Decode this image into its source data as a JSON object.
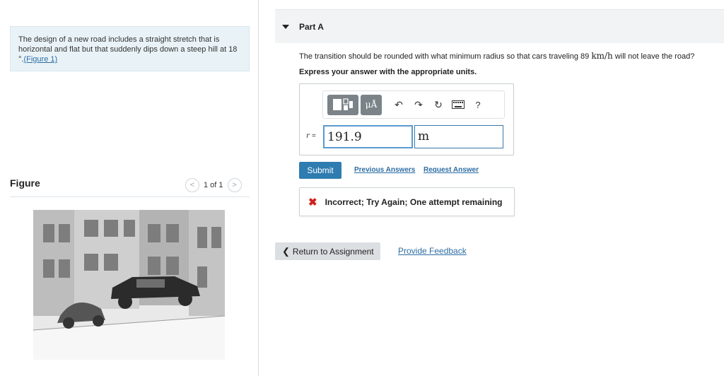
{
  "problem": {
    "text": "The design of a new road includes a straight stretch that is horizontal and flat but that suddenly dips down a steep hill at 18 °.",
    "figure_link": "(Figure 1)"
  },
  "figure": {
    "title": "Figure",
    "pager_text": "1 of 1",
    "prev_icon": "chevron-left-icon",
    "next_icon": "chevron-right-icon"
  },
  "part": {
    "title": "Part A",
    "question_before": "The transition should be rounded with what minimum radius so that cars traveling 89 ",
    "question_unit": "km/h",
    "question_after": " will not leave the road?",
    "instruction": "Express your answer with the appropriate units."
  },
  "answer": {
    "variable": "r",
    "equals": "=",
    "value": "191.9",
    "unit": "m",
    "toolbar": {
      "units_label": "μÅ",
      "undo_icon": "undo-icon",
      "redo_icon": "redo-icon",
      "reset_icon": "reset-icon",
      "keyboard_icon": "keyboard-icon",
      "help_label": "?"
    }
  },
  "actions": {
    "submit": "Submit",
    "previous_answers": "Previous Answers",
    "request_answer": "Request Answer"
  },
  "feedback": {
    "icon": "x-icon",
    "text": "Incorrect; Try Again; One attempt remaining",
    "color": "#d0211c"
  },
  "footer": {
    "return": "Return to Assignment",
    "provide_feedback": "Provide Feedback"
  },
  "colors": {
    "accent": "#2e7cb0",
    "link": "#2d6da3",
    "problem_bg": "#e9f3f7"
  }
}
